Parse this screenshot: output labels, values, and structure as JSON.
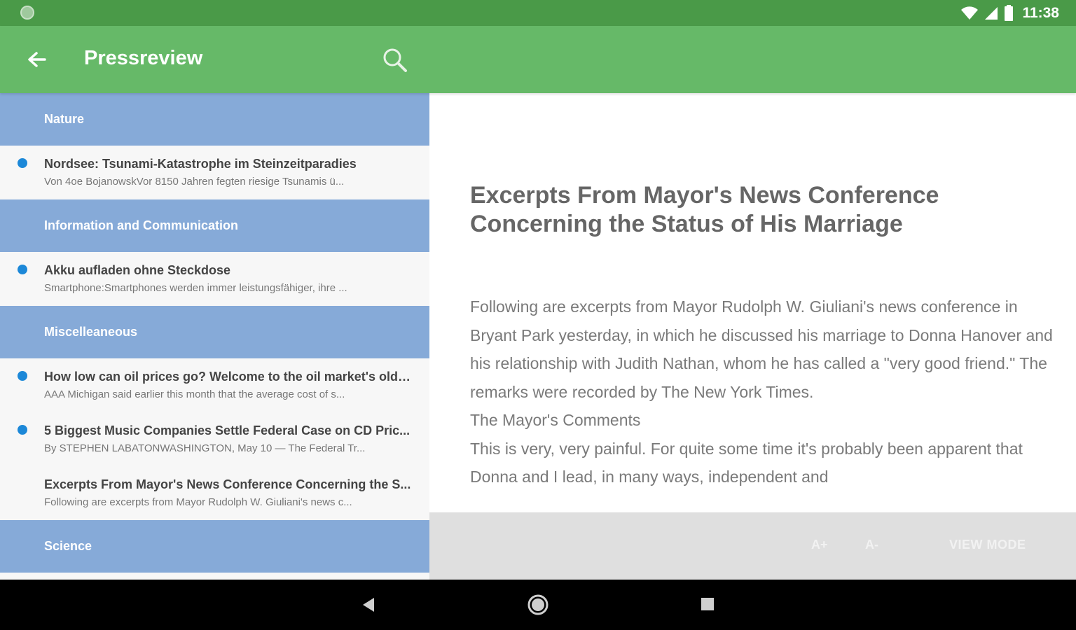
{
  "status_bar": {
    "time": "11:38"
  },
  "app_bar": {
    "title": "Pressreview"
  },
  "list": [
    {
      "type": "category",
      "label": "Nature"
    },
    {
      "type": "article",
      "unread": true,
      "title": "Nordsee: Tsunami-Katastrophe im Steinzeitparadies",
      "snippet": "Von 4oe BojanowskVor 8150 Jahren fegten riesige Tsunamis ü..."
    },
    {
      "type": "category",
      "label": "Information and Communication"
    },
    {
      "type": "article",
      "unread": true,
      "title": "Akku aufladen ohne Steckdose",
      "snippet": "Smartphone:Smartphones werden immer leistungsfähiger, ihre ..."
    },
    {
      "type": "category",
      "label": "Miscelleaneous"
    },
    {
      "type": "article",
      "unread": true,
      "title": "How low can oil prices go? Welcome to the oil market's old n...",
      "snippet": "AAA Michigan said earlier this month that the average cost of s..."
    },
    {
      "type": "article",
      "unread": true,
      "title": "5 Biggest Music Companies Settle Federal Case on CD Pric...",
      "snippet": "By STEPHEN LABATONWASHINGTON, May 10 — The Federal Tr..."
    },
    {
      "type": "article",
      "unread": false,
      "title": "Excerpts From Mayor's News Conference Concerning the S...",
      "snippet": "Following are excerpts from Mayor Rudolph W. Giuliani's news c..."
    },
    {
      "type": "category",
      "label": "Science"
    }
  ],
  "reader": {
    "title": "Excerpts From Mayor's News Conference Concerning the Status of His Marriage",
    "paragraphs": [
      "Following are excerpts from Mayor Rudolph W. Giuliani's news conference in Bryant Park yesterday, in which he discussed his marriage to Donna Hanover and his relationship with Judith Nathan, whom he has called a \"very good friend.\" The remarks were recorded by The New York Times.",
      "The Mayor's Comments",
      "This is very, very painful. For quite some time it's probably been apparent that Donna and I lead, in many ways, independent and"
    ],
    "toolbar": {
      "font_plus": "A+",
      "font_minus": "A-",
      "view_mode": "VIEW MODE"
    }
  },
  "colors": {
    "status_bar": "#4a9a48",
    "app_bar": "#66b968",
    "category": "#86aad8",
    "unread_dot": "#1c88d8"
  },
  "icons": {
    "back": "arrow-left-icon",
    "search": "magnifier-icon",
    "nav_back": "triangle-back-icon",
    "nav_home": "circle-home-icon",
    "nav_recents": "square-recents-icon"
  }
}
